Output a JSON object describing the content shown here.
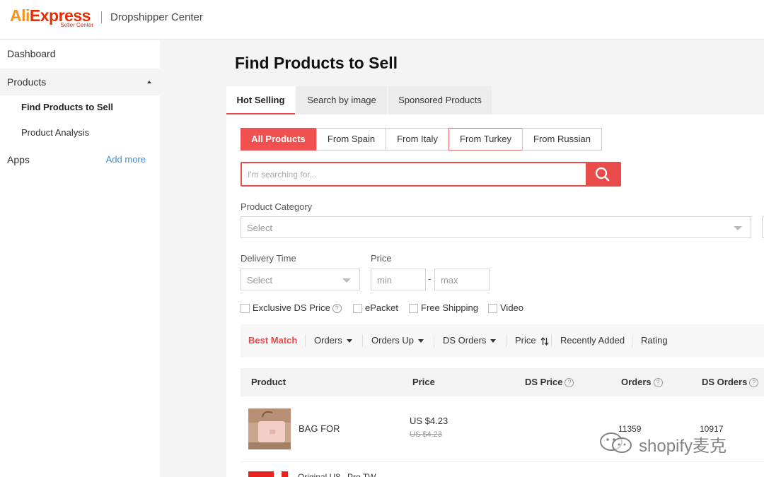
{
  "header": {
    "logo_main_a": "Ali",
    "logo_main_b": "Express",
    "logo_sub": "Seller Center",
    "title": "Dropshipper Center"
  },
  "sidebar": {
    "dashboard": "Dashboard",
    "products": "Products",
    "sub_items": [
      "Find Products to Sell",
      "Product Analysis"
    ],
    "apps": "Apps",
    "add_more": "Add more"
  },
  "main": {
    "page_title": "Find Products to Sell",
    "tabs": [
      "Hot Selling",
      "Search by image",
      "Sponsored Products"
    ],
    "segments": [
      "All Products",
      "From Spain",
      "From Italy",
      "From Turkey",
      "From Russian"
    ],
    "search_placeholder": "I'm searching for...",
    "category_label": "Product Category",
    "category_value": "Select",
    "delivery_label": "Delivery Time",
    "delivery_value": "Select",
    "price_label": "Price",
    "price_min": "min",
    "price_dash": "-",
    "price_max": "max",
    "checkboxes": [
      "Exclusive DS Price",
      "ePacket",
      "Free Shipping",
      "Video"
    ],
    "sort": [
      "Best Match",
      "Orders",
      "Orders Up",
      "DS Orders",
      "Price",
      "Recently Added",
      "Rating"
    ],
    "columns": [
      "Product",
      "Price",
      "DS Price",
      "Orders",
      "DS Orders"
    ],
    "help_glyph": "?",
    "rows": [
      {
        "name": "BAG FOR",
        "price": "US $4.23",
        "old_price": "US $4.23",
        "orders": "11359",
        "ds_orders": "10917"
      }
    ],
    "row2_text": "Original U8...Pro TW..."
  },
  "watermark": "shopify麦克",
  "colors": {
    "accent": "#e94b4b",
    "brand_orange": "#f6921e",
    "brand_red": "#e62e04",
    "link": "#3a8fd8"
  }
}
